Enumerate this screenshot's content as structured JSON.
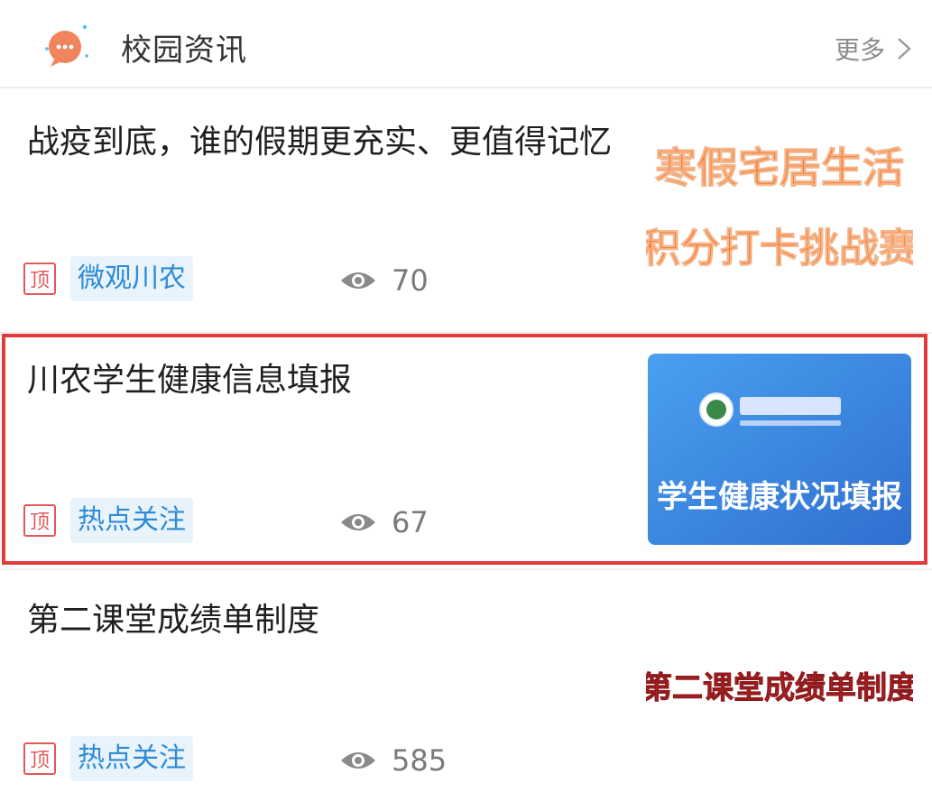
{
  "header": {
    "title": "校园资讯",
    "more_label": "更多",
    "icon": "chat-bubble-icon"
  },
  "news": [
    {
      "title": "战疫到底，谁的假期更充实、更值得记忆",
      "badge": "顶",
      "tag": "微观川农",
      "views": "70",
      "thumbnail": {
        "line1": "寒假宅居生活",
        "line2": "积分打卡挑战赛",
        "color": "#f07a2a"
      }
    },
    {
      "title": "川农学生健康信息填报",
      "badge": "顶",
      "tag": "热点关注",
      "views": "67",
      "thumbnail": {
        "line1": "学生健康状况填报",
        "color": "#3b8be0"
      },
      "highlighted": true
    },
    {
      "title": "第二课堂成绩单制度",
      "badge": "顶",
      "tag": "热点关注",
      "views": "585",
      "thumbnail": {
        "line1": "第二课堂成绩单制度",
        "color": "#c0282b"
      }
    }
  ],
  "colors": {
    "accent": "#2f8bd6",
    "badge": "#e05a5a",
    "highlight": "#e23a3a"
  }
}
